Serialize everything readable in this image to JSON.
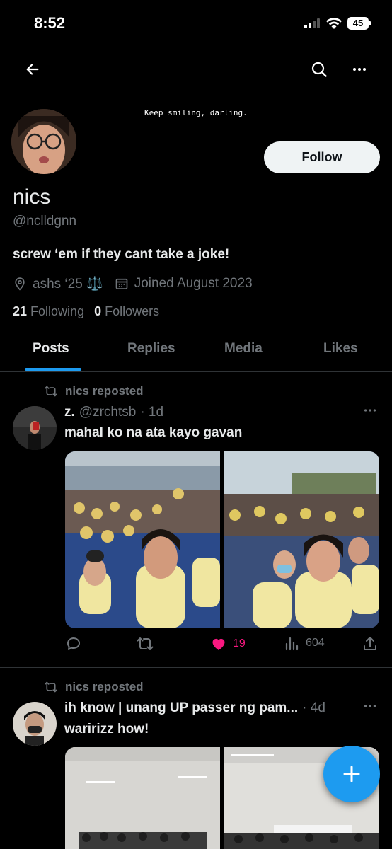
{
  "status_bar": {
    "time": "8:52",
    "battery": "45"
  },
  "profile": {
    "banner_text": "Keep smiling, darling.",
    "follow_label": "Follow",
    "display_name": "nics",
    "handle": "@nclldgnn",
    "bio": "screw ‘em if they cant take a joke!",
    "location": "ashs ‘25 ⚖️",
    "joined": "Joined August 2023",
    "following_count": "21",
    "following_label": "Following",
    "followers_count": "0",
    "followers_label": "Followers"
  },
  "tabs": [
    {
      "label": "Posts",
      "active": true
    },
    {
      "label": "Replies"
    },
    {
      "label": "Media"
    },
    {
      "label": "Likes"
    }
  ],
  "posts": [
    {
      "repost_label": "nics reposted",
      "author_name": "z.",
      "author_handle": "@zrchtsb",
      "time": "· 1d",
      "text": "mahal ko na ata kayo gavan",
      "replies": "",
      "reposts": "",
      "likes": "19",
      "views": "604"
    },
    {
      "repost_label": "nics reposted",
      "author_name": "ih know | unang UP passer ng pam...",
      "time": "· 4d",
      "text": "waririzz how!"
    }
  ],
  "icons": {
    "back": "arrow-left-icon",
    "search": "search-icon",
    "more": "more-icon",
    "location": "location-pin-icon",
    "calendar": "calendar-icon",
    "repost": "repost-icon",
    "reply": "reply-icon",
    "like": "heart-icon",
    "views": "views-icon",
    "share": "share-icon",
    "compose": "plus-icon"
  },
  "colors": {
    "accent": "#1d9bf0",
    "like": "#f91880",
    "muted": "#71767b"
  }
}
